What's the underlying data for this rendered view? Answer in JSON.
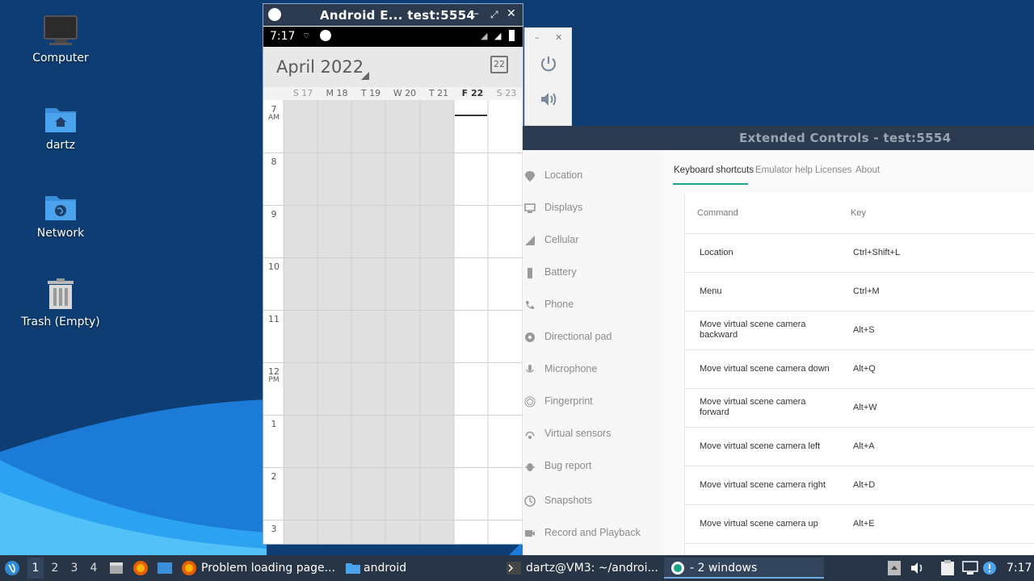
{
  "desktop": {
    "icons": [
      {
        "label": "Computer"
      },
      {
        "label": "dartz"
      },
      {
        "label": "Network"
      },
      {
        "label": "Trash (Empty)"
      }
    ]
  },
  "emulator": {
    "title": "Android E... test:5554",
    "status_time": "7:17",
    "calendar": {
      "month": "April 2022",
      "today_icon": "22",
      "days": [
        "S 17",
        "M 18",
        "T 19",
        "W 20",
        "T 21",
        "F 22",
        "S 23"
      ],
      "hours": [
        {
          "h": "7",
          "ampm": "AM"
        },
        {
          "h": "8",
          "ampm": ""
        },
        {
          "h": "9",
          "ampm": ""
        },
        {
          "h": "10",
          "ampm": ""
        },
        {
          "h": "11",
          "ampm": ""
        },
        {
          "h": "12",
          "ampm": "PM"
        },
        {
          "h": "1",
          "ampm": ""
        },
        {
          "h": "2",
          "ampm": ""
        },
        {
          "h": "3",
          "ampm": ""
        }
      ]
    }
  },
  "extended_controls": {
    "title": "Extended Controls - test:5554",
    "nav": [
      "Location",
      "Displays",
      "Cellular",
      "Battery",
      "Phone",
      "Directional pad",
      "Microphone",
      "Fingerprint",
      "Virtual sensors",
      "Bug report",
      "Snapshots",
      "Record and Playback"
    ],
    "tabs": [
      "Keyboard shortcuts",
      "Emulator help",
      "Licenses",
      "About"
    ],
    "table": {
      "col_command": "Command",
      "col_key": "Key",
      "rows": [
        {
          "command": "Location",
          "key": "Ctrl+Shift+L"
        },
        {
          "command": "Menu",
          "key": "Ctrl+M"
        },
        {
          "command": "Move virtual scene camera backward",
          "key": "Alt+S"
        },
        {
          "command": "Move virtual scene camera down",
          "key": "Alt+Q"
        },
        {
          "command": "Move virtual scene camera forward",
          "key": "Alt+W"
        },
        {
          "command": "Move virtual scene camera left",
          "key": "Alt+A"
        },
        {
          "command": "Move virtual scene camera right",
          "key": "Alt+D"
        },
        {
          "command": "Move virtual scene camera up",
          "key": "Alt+E"
        }
      ]
    }
  },
  "taskbar": {
    "workspaces": [
      "1",
      "2",
      "3",
      "4"
    ],
    "tasks": [
      {
        "label": "Problem loading page..."
      },
      {
        "label": "android"
      },
      {
        "label": "dartz@VM3: ~/androi..."
      },
      {
        "label": "- 2 windows"
      }
    ],
    "clock": "7:17"
  },
  "colors": {
    "desktop_bg": "#0d3d73",
    "titlebar": "#2b3a4f",
    "accent_teal": "#19a689",
    "taskbar": "#283547"
  }
}
